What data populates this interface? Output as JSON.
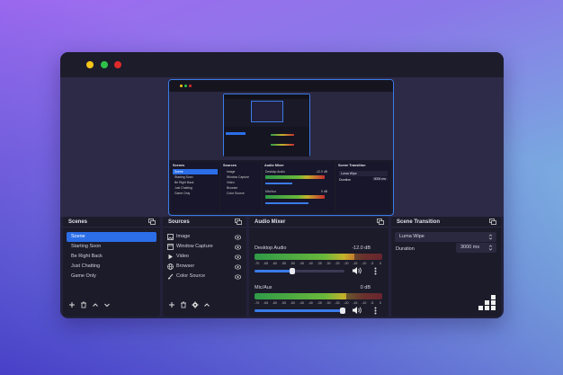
{
  "window": {
    "dots": [
      "#f5c518",
      "#2ec24a",
      "#e02a2a"
    ]
  },
  "scenes": {
    "title": "Scenes",
    "items": [
      "Scene",
      "Starting Soon",
      "Be Right Back",
      "Just Chatting",
      "Game Only"
    ],
    "selected": "Scene",
    "footer_icons": [
      "plus-icon",
      "trash-icon",
      "chevron-up-icon",
      "chevron-down-icon"
    ]
  },
  "sources": {
    "title": "Sources",
    "items": [
      {
        "label": "Image",
        "icon": "image-icon"
      },
      {
        "label": "Window Capture",
        "icon": "window-capture-icon"
      },
      {
        "label": "Video",
        "icon": "play-icon"
      },
      {
        "label": "Browser",
        "icon": "globe-icon"
      },
      {
        "label": "Color Source",
        "icon": "brush-icon"
      }
    ],
    "footer_icons": [
      "plus-icon",
      "trash-icon",
      "gear-icon",
      "chevron-up-icon"
    ]
  },
  "audio_mixer": {
    "title": "Audio Mixer",
    "scale": [
      "-70",
      "-65",
      "-60",
      "-55",
      "-50",
      "-45",
      "-40",
      "-35",
      "-30",
      "-25",
      "-20",
      "-15",
      "-10",
      "-5",
      "0"
    ],
    "channels": [
      {
        "name": "Desktop Audio",
        "level": "-12.0 dB",
        "meter": 0.78,
        "volume": 0.42
      },
      {
        "name": "Mic/Aux",
        "level": "0 dB",
        "meter": 0.72,
        "volume": 0.98
      }
    ]
  },
  "scene_transition": {
    "title": "Scene Transition",
    "transition": "Luma Wipe",
    "duration_label": "Duration",
    "duration_value": "3000 ms"
  },
  "preview_mini": {
    "scenes": [
      "Scene",
      "Starting Soon",
      "Be Right Back",
      "Just Chatting",
      "Game Only"
    ],
    "sources": [
      "Image",
      "Window Capture",
      "Video",
      "Browser",
      "Color Source"
    ],
    "channels": [
      {
        "name": "Desktop Audio",
        "level": "-12.0 dB"
      },
      {
        "name": "Mic/Aux",
        "level": "0 dB"
      }
    ],
    "transition": "Luma Wipe",
    "duration_label": "Duration",
    "duration_value": "3000 ms"
  },
  "colors": {
    "accent": "#2b6ee8",
    "panel": "#1c1b2a",
    "canvas": "#2d2a48"
  }
}
